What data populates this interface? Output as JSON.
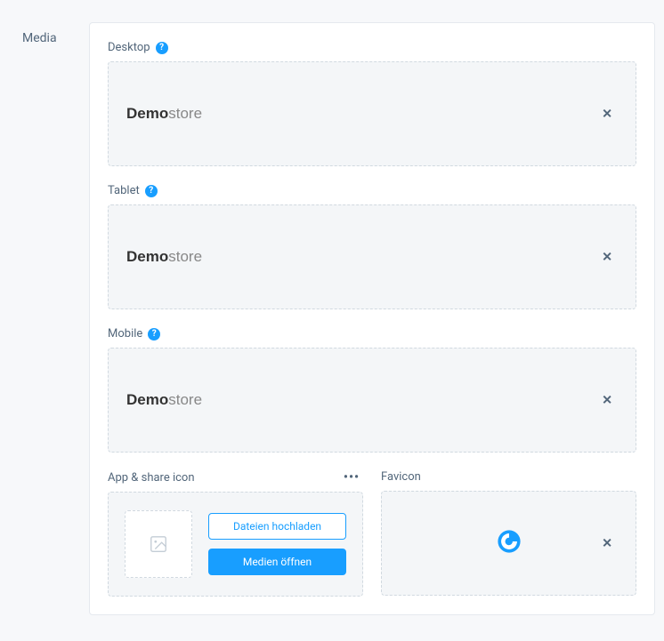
{
  "section_label": "Media",
  "fields": {
    "desktop": {
      "label": "Desktop",
      "logo_bold": "Demo",
      "logo_light": "store",
      "has_help": true
    },
    "tablet": {
      "label": "Tablet",
      "logo_bold": "Demo",
      "logo_light": "store",
      "has_help": true
    },
    "mobile": {
      "label": "Mobile",
      "logo_bold": "Demo",
      "logo_light": "store",
      "has_help": true
    },
    "app_share": {
      "label": "App & share icon"
    },
    "favicon": {
      "label": "Favicon"
    }
  },
  "buttons": {
    "upload": "Dateien hochladen",
    "open_media": "Medien öffnen"
  },
  "icons": {
    "help": "?",
    "close": "✕",
    "more": "•••"
  }
}
